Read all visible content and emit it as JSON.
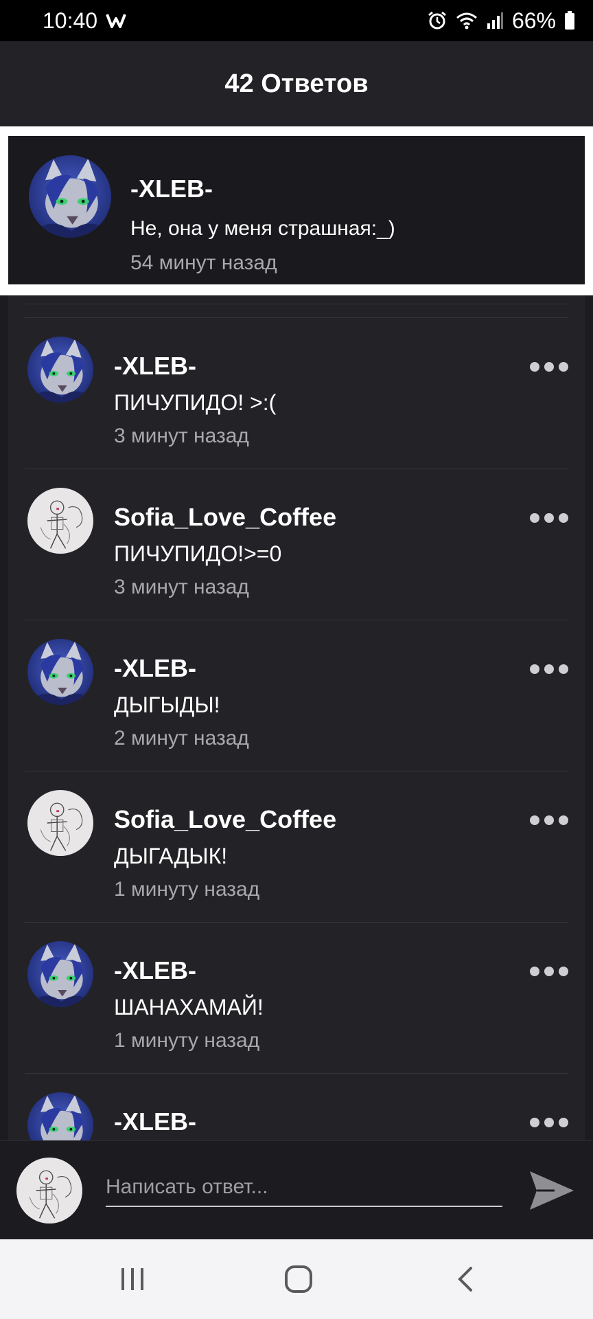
{
  "status_bar": {
    "time": "10:40",
    "battery": "66%",
    "icons": [
      "w-app-icon",
      "alarm-icon",
      "wifi-icon",
      "signal-icon",
      "battery-icon"
    ]
  },
  "header": {
    "title": "42 Ответов"
  },
  "parent_comment": {
    "author": "-XLEB-",
    "text": "Не, она у меня страшная:_)",
    "time": "54 минут назад",
    "avatar": "wolf-avatar"
  },
  "replies": [
    {
      "author": "-XLEB-",
      "text": "ПИЧУПИДО! >:(",
      "time": "3 минут назад",
      "avatar": "wolf-avatar"
    },
    {
      "author": "Sofia_Love_Coffee",
      "text": "ПИЧУПИДО!>=0",
      "time": "3 минут назад",
      "avatar": "sketch-avatar"
    },
    {
      "author": "-XLEB-",
      "text": "ДЫГЫДЫ!",
      "time": "2 минут назад",
      "avatar": "wolf-avatar"
    },
    {
      "author": "Sofia_Love_Coffee",
      "text": "ДЫГАДЫК!",
      "time": "1 минуту назад",
      "avatar": "sketch-avatar"
    },
    {
      "author": "-XLEB-",
      "text": "ШАНАХАМАЙ!",
      "time": "1 минуту назад",
      "avatar": "wolf-avatar"
    },
    {
      "author": "-XLEB-",
      "text": "",
      "time": "",
      "avatar": "wolf-avatar"
    }
  ],
  "composer": {
    "placeholder": "Написать ответ...",
    "avatar": "sketch-avatar",
    "send_icon": "send-icon"
  },
  "colors": {
    "background": "#1c1b1f",
    "card": "#232226",
    "highlight_border": "#ffffff",
    "secondary_text": "#a8a8ad",
    "navbar": "#f4f4f6"
  },
  "navbar": {
    "icons": [
      "recent-apps-icon",
      "home-icon",
      "back-icon"
    ]
  }
}
